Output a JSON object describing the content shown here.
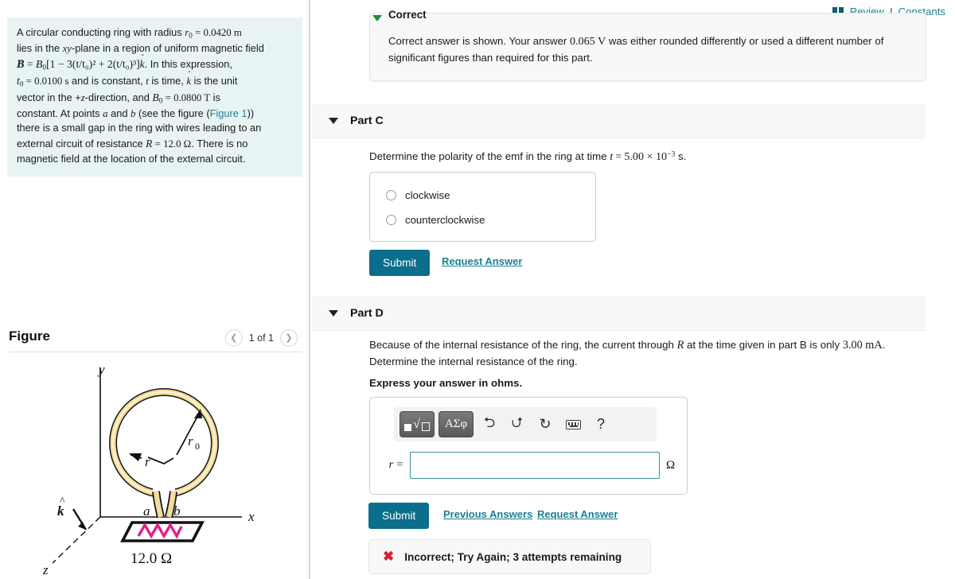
{
  "header": {
    "review_label": "Review",
    "separator": "I",
    "constants_label": "Constants",
    "book_icon": "book-icon"
  },
  "problem": {
    "line1_a": "A circular conducting ring with radius ",
    "r0_sym": "r",
    "r0_sub": "0",
    "eq": " = ",
    "r0_val": "0.0420 m",
    "line2": "lies in the ",
    "xy": "xy",
    "line2b": "-plane in a region of uniform magnetic field",
    "B_vec": "B",
    "B0": "B",
    "B0_sub": "0",
    "bracket_expr": "[1 − 3(t/t₀)² + 2(t/t₀)³]",
    "khat": "k",
    "line3_tail": ". In this expression,",
    "t0_sym": "t",
    "t0_sub": "0",
    "t0_val": "0.0100 s",
    "line4b": " and is constant, ",
    "t_sym": "t",
    "line4c": " is time, ",
    "line4d": " is the unit",
    "line5": "vector in the +",
    "z_sym": "z",
    "line5b": "-direction, and ",
    "B0_val": "0.0800 T",
    "line5c": " is",
    "line6": "constant. At points ",
    "a_sym": "a",
    "line6b": " and ",
    "b_sym": "b",
    "line6c": " (see the figure (",
    "figure_link": "Figure 1",
    "line6d": "))",
    "line7": "there is a small gap in the ring with wires leading to an",
    "line8": "external circuit of resistance ",
    "R_sym": "R",
    "R_val": "12.0 Ω",
    "line8b": ". There is no",
    "line9": "magnetic field at the location of the external circuit."
  },
  "figure": {
    "title": "Figure",
    "counter": "1 of 1",
    "prev_icon": "chevron-left-icon",
    "next_icon": "chevron-right-icon",
    "labels": {
      "y_axis": "y",
      "x_axis": "x",
      "z_axis": "z",
      "k_hat": "k",
      "r0": "r",
      "r0_sub": "0",
      "r": "r",
      "point_a": "a",
      "point_b": "b",
      "resistance": "12.0 Ω"
    },
    "colors": {
      "ring": "#f5dd9a",
      "ring_edge": "#1a1a1a",
      "resistor": "#e0218a"
    }
  },
  "feedback_correct": {
    "heading": "Correct",
    "caret_icon": "caret-down-icon",
    "body": "Correct answer is shown. Your answer 0.065 V was either rounded differently or used a different number of significant figures than required for this part.",
    "body_pre": "Correct answer is shown. Your answer ",
    "body_value": "0.065 V",
    "body_post": " was either rounded differently or used a different number of significant figures than required for this part."
  },
  "part_c": {
    "label": "Part C",
    "caret_icon": "caret-down-icon",
    "prompt_pre": "Determine the polarity of the emf in the ring at time ",
    "prompt_t": "t",
    "prompt_eq": " = ",
    "prompt_val": "5.00 × 10",
    "prompt_exp": "−3",
    "prompt_unit": " s.",
    "options": [
      {
        "label": "clockwise",
        "selected": false
      },
      {
        "label": "counterclockwise",
        "selected": false
      }
    ],
    "submit_label": "Submit",
    "request_answer_label": "Request Answer"
  },
  "part_d": {
    "label": "Part D",
    "caret_icon": "caret-down-icon",
    "prompt_pre": "Because of the internal resistance of the ring, the current through ",
    "prompt_R": "R",
    "prompt_mid": " at the time given in part B is only ",
    "prompt_val": "3.00 mA",
    "prompt_post": ". Determine the internal resistance of the ring.",
    "instruction": "Express your answer in ohms.",
    "toolbar": {
      "template_button": "template-sqrt-button",
      "template_root_glyph": "√",
      "greek_button_label": "ΑΣφ",
      "undo_icon": "undo-arrow-icon",
      "undo_glyph": "⮌",
      "redo_icon": "redo-arrow-icon",
      "redo_glyph": "⮍",
      "reset_icon": "reset-circular-arrow-icon",
      "reset_glyph": "↻",
      "keyboard_icon": "keyboard-icon",
      "help_icon": "help-question-icon",
      "help_glyph": "?"
    },
    "answer_label": "r =",
    "answer_value": "",
    "answer_placeholder": "",
    "answer_unit": "Ω",
    "submit_label": "Submit",
    "previous_answers_label": "Previous Answers",
    "request_answer_label": "Request Answer",
    "alert": {
      "icon": "x-mark-icon",
      "glyph": "✖",
      "text": "Incorrect; Try Again; 3 attempts remaining"
    }
  },
  "colors": {
    "accent_teal": "#0a6e8c",
    "link_teal": "#1b7f95",
    "problem_bg": "#e7f4f3",
    "panel_bg": "#f8f8f8",
    "error_red": "#d81e2c",
    "success_green": "#1a8f3c"
  }
}
